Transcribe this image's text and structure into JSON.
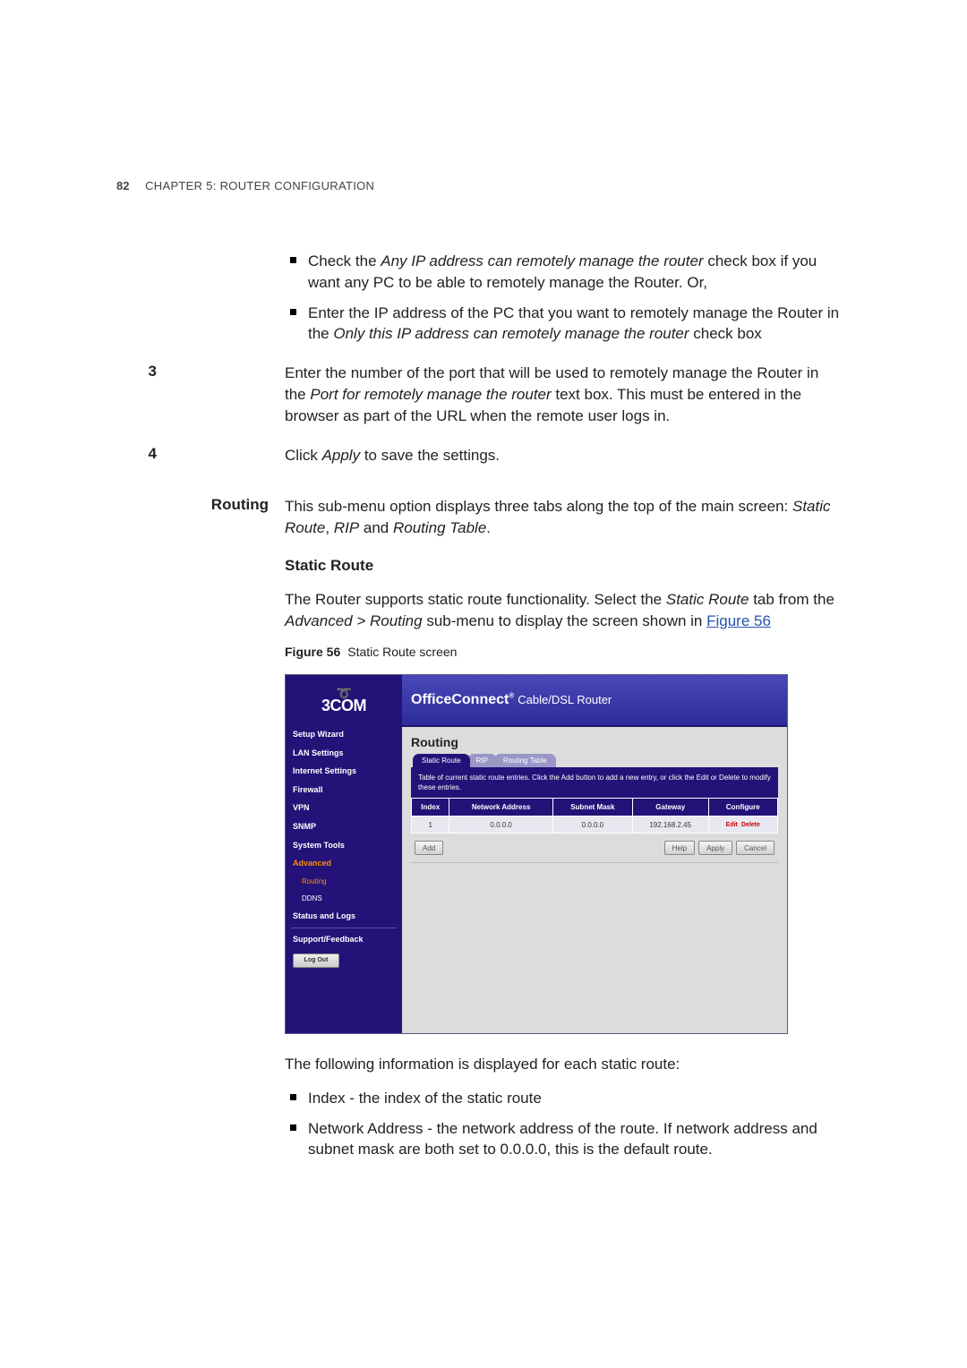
{
  "page_number": "82",
  "chapter_label_a": "C",
  "chapter_label_b": "HAPTER",
  "chapter_label_c": " 5: R",
  "chapter_label_d": "OUTER",
  "chapter_label_e": " C",
  "chapter_label_f": "ONFIGURATION",
  "b1a": "Check the ",
  "b1b": "Any IP address can remotely manage the router",
  "b1c": " check box if you want any PC to be able to remotely manage the Router. Or,",
  "b2a": "Enter the IP address of the PC that you want to remotely manage the Router in the ",
  "b2b": "Only this IP address can remotely manage the router",
  "b2c": " check box",
  "step3_num": "3",
  "step3a": "Enter the number of the port that will be used to remotely manage the Router in the ",
  "step3b": "Port for remotely manage the router",
  "step3c": " text box. This must be entered in the browser as part of the URL when the remote user logs in.",
  "step4_num": "4",
  "step4a": "Click ",
  "step4b": "Apply",
  "step4c": " to save the settings.",
  "routing_label": "Routing",
  "routing_para_a": "This sub-menu option displays three tabs along the top of the main screen: ",
  "routing_para_b": "Static Route",
  "routing_para_c": ", ",
  "routing_para_d": "RIP",
  "routing_para_e": " and ",
  "routing_para_f": "Routing Table",
  "routing_para_g": ".",
  "sr_heading": "Static Route",
  "sr_para_a": "The Router supports static route functionality. Select the ",
  "sr_para_b": "Static Route",
  "sr_para_c": " tab from the ",
  "sr_para_d": "Advanced > Routing",
  "sr_para_e": " sub-menu to display the screen shown in ",
  "sr_link": "Figure 56",
  "fig_label": "Figure 56",
  "fig_title": "Static Route screen",
  "after_fig": "The following information is displayed for each static route:",
  "li_a": "Index - the index of the static route",
  "li_b": "Network Address - the network address of the route. If network address and subnet mask are both set to 0.0.0.0, this is the default route.",
  "ss": {
    "brand": "3COM",
    "nav": {
      "setup": "Setup Wizard",
      "lan": "LAN Settings",
      "internet": "Internet Settings",
      "firewall": "Firewall",
      "vpn": "VPN",
      "snmp": "SNMP",
      "systools": "System Tools",
      "advanced": "Advanced",
      "routing": "Routing",
      "ddns": "DDNS",
      "status": "Status and Logs",
      "support": "Support/Feedback",
      "logout": "Log Out"
    },
    "header_a": "OfficeConnect",
    "header_b": "Cable/DSL Router",
    "panel_title": "Routing",
    "tabs": {
      "sr": "Static Route",
      "rip": "RIP",
      "rt": "Routing Table"
    },
    "desc": "Table of current static route entries. Click the Add button to add a new entry, or click the Edit or Delete to modify these entries.",
    "th": {
      "idx": "Index",
      "na": "Network Address",
      "sm": "Subnet Mask",
      "gw": "Gateway",
      "cf": "Configure"
    },
    "row": {
      "idx": "1",
      "na": "0.0.0.0",
      "sm": "0.0.0.0",
      "gw": "192.168.2.45",
      "edit": "Edit",
      "del": "Delete"
    },
    "btn": {
      "add": "Add",
      "help": "Help",
      "apply": "Apply",
      "cancel": "Cancel"
    }
  }
}
